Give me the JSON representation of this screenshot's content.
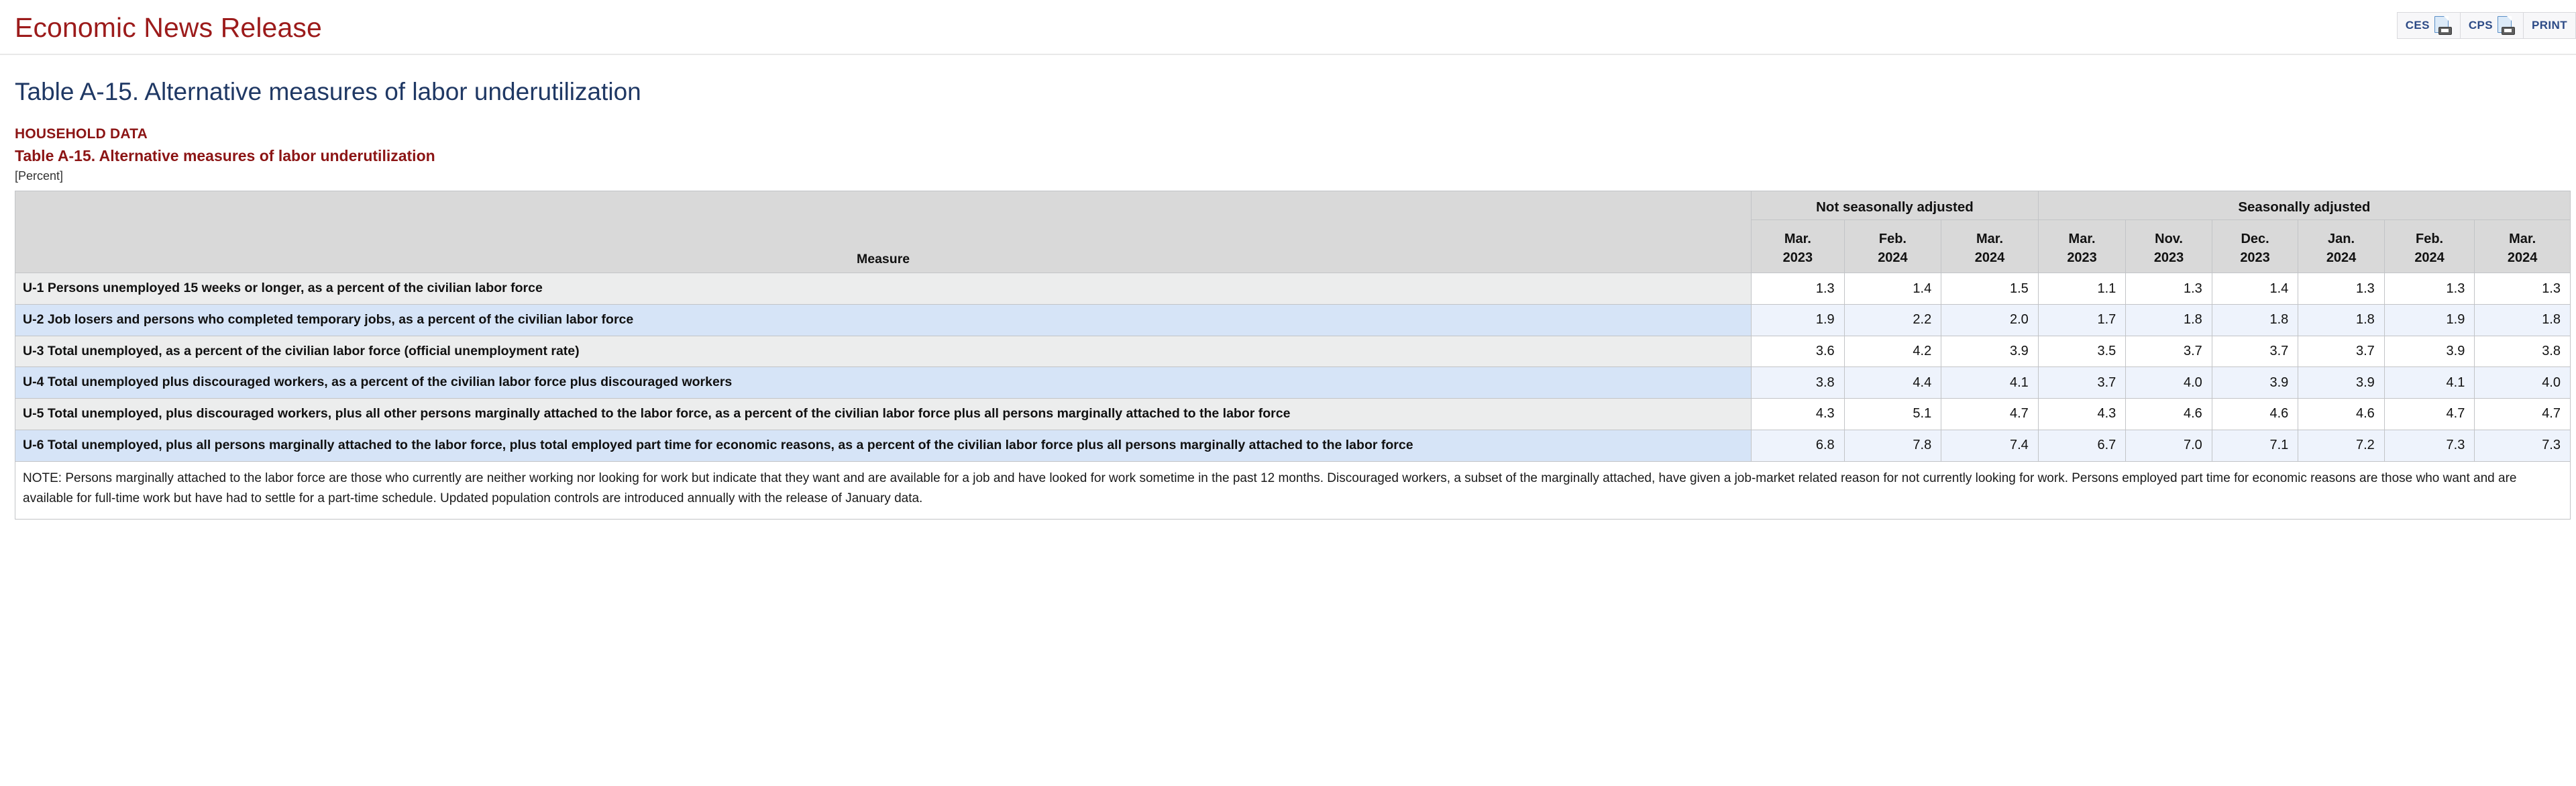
{
  "header": {
    "site_title": "Economic News Release",
    "buttons": [
      {
        "label": "CES",
        "icon": "document-print-icon"
      },
      {
        "label": "CPS",
        "icon": "document-print-icon"
      },
      {
        "label": "PRINT",
        "icon": "none"
      }
    ]
  },
  "page_title": "Table A-15. Alternative measures of labor underutilization",
  "meta": {
    "household_data": "HOUSEHOLD DATA",
    "table_subtitle": "Table A-15. Alternative measures of labor underutilization",
    "units": "[Percent]"
  },
  "table": {
    "stub_header": "Measure",
    "groups": [
      {
        "label": "Not seasonally adjusted",
        "span": 3
      },
      {
        "label": "Seasonally adjusted",
        "span": 6
      }
    ],
    "periods": [
      {
        "month": "Mar.",
        "year": "2023"
      },
      {
        "month": "Feb.",
        "year": "2024"
      },
      {
        "month": "Mar.",
        "year": "2024"
      },
      {
        "month": "Mar.",
        "year": "2023"
      },
      {
        "month": "Nov.",
        "year": "2023"
      },
      {
        "month": "Dec.",
        "year": "2023"
      },
      {
        "month": "Jan.",
        "year": "2024"
      },
      {
        "month": "Feb.",
        "year": "2024"
      },
      {
        "month": "Mar.",
        "year": "2024"
      }
    ],
    "rows": [
      {
        "measure": "U-1 Persons unemployed 15 weeks or longer, as a percent of the civilian labor force",
        "values": [
          "1.3",
          "1.4",
          "1.5",
          "1.1",
          "1.3",
          "1.4",
          "1.3",
          "1.3",
          "1.3"
        ]
      },
      {
        "measure": "U-2 Job losers and persons who completed temporary jobs, as a percent of the civilian labor force",
        "values": [
          "1.9",
          "2.2",
          "2.0",
          "1.7",
          "1.8",
          "1.8",
          "1.8",
          "1.9",
          "1.8"
        ]
      },
      {
        "measure": "U-3 Total unemployed, as a percent of the civilian labor force (official unemployment rate)",
        "values": [
          "3.6",
          "4.2",
          "3.9",
          "3.5",
          "3.7",
          "3.7",
          "3.7",
          "3.9",
          "3.8"
        ]
      },
      {
        "measure": "U-4 Total unemployed plus discouraged workers, as a percent of the civilian labor force plus discouraged workers",
        "values": [
          "3.8",
          "4.4",
          "4.1",
          "3.7",
          "4.0",
          "3.9",
          "3.9",
          "4.1",
          "4.0"
        ]
      },
      {
        "measure": "U-5 Total unemployed, plus discouraged workers, plus all other persons marginally attached to the labor force, as a percent of the civilian labor force plus all persons marginally attached to the labor force",
        "values": [
          "4.3",
          "5.1",
          "4.7",
          "4.3",
          "4.6",
          "4.6",
          "4.6",
          "4.7",
          "4.7"
        ]
      },
      {
        "measure": "U-6 Total unemployed, plus all persons marginally attached to the labor force, plus total employed part time for economic reasons, as a percent of the civilian labor force plus all persons marginally attached to the labor force",
        "values": [
          "6.8",
          "7.8",
          "7.4",
          "6.7",
          "7.0",
          "7.1",
          "7.2",
          "7.3",
          "7.3"
        ]
      }
    ],
    "note": "NOTE: Persons marginally attached to the labor force are those who currently are neither working nor looking for work but indicate that they want and are available for a job and have looked for work sometime in the past 12 months. Discouraged workers, a subset of the marginally attached, have given a job-market related reason for not currently looking for work. Persons employed part time for economic reasons are those who want and are available for full-time work but have had to settle for a part-time schedule. Updated population controls are introduced annually with the release of January data."
  },
  "colors": {
    "site_title": "#9c1b1b",
    "page_title": "#1f3864",
    "meta_red": "#8c1515",
    "header_bg": "#d9d9d9",
    "row_odd": "#eceded",
    "row_even": "#d6e4f7"
  }
}
